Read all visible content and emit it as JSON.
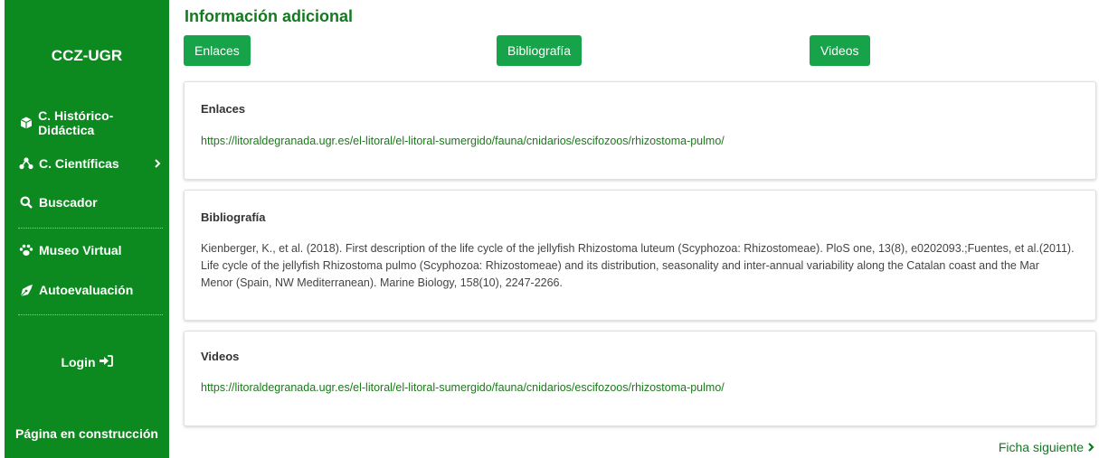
{
  "sidebar": {
    "brand": "CCZ-UGR",
    "items": [
      {
        "label": "C. Histórico-Didáctica",
        "icon": "box-icon"
      },
      {
        "label": "C. Científicas",
        "icon": "hierarchy-icon",
        "has_submenu": true
      },
      {
        "label": "Buscador",
        "icon": "search-icon"
      },
      {
        "label": "Museo Virtual",
        "icon": "paw-icon"
      },
      {
        "label": "Autoevaluación",
        "icon": "pen-nib-icon"
      }
    ],
    "login_label": "Login",
    "footer_note": "Página en construcción",
    "background_color": "#0d8a1f"
  },
  "main": {
    "title": "Información adicional",
    "tabs": [
      {
        "label": "Enlaces"
      },
      {
        "label": "Bibliografía"
      },
      {
        "label": "Videos"
      }
    ],
    "sections": {
      "enlaces": {
        "heading": "Enlaces",
        "link": "https://litoraldegranada.ugr.es/el-litoral/el-litoral-sumergido/fauna/cnidarios/escifozoos/rhizostoma-pulmo/"
      },
      "bibliografia": {
        "heading": "Bibliografía",
        "lines": [
          "Kienberger, K., et al. (2018). First description of the life cycle of the jellyfish Rhizostoma luteum (Scyphozoa: Rhizostomeae). PloS one, 13(8), e0202093.;Fuentes, et al.(2011).",
          "Life cycle of the jellyfish Rhizostoma pulmo (Scyphozoa: Rhizostomeae) and its distribution, seasonality and inter-annual variability along the Catalan coast and the Mar",
          "Menor (Spain, NW Mediterranean). Marine Biology, 158(10), 2247-2266."
        ]
      },
      "videos": {
        "heading": "Videos",
        "link": "https://litoraldegranada.ugr.es/el-litoral/el-litoral-sumergido/fauna/cnidarios/escifozoos/rhizostoma-pulmo/"
      }
    },
    "next_label": "Ficha siguiente",
    "accent_color": "#17a34a"
  }
}
